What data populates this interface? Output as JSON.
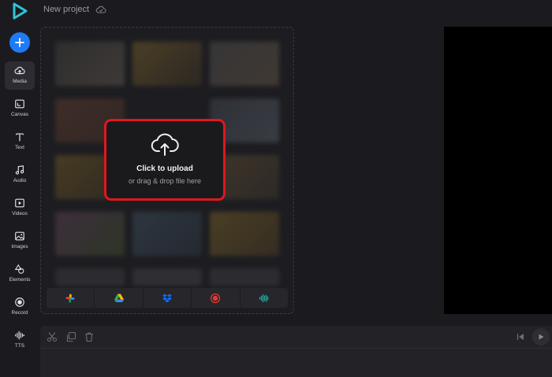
{
  "header": {
    "project_title": "New project",
    "logo_icon": "play-logo-icon",
    "save_status_icon": "cloud-icon"
  },
  "sidebar": {
    "add_icon": "plus-icon",
    "items": [
      {
        "label": "Media",
        "icon": "cloud-upload-icon",
        "active": true
      },
      {
        "label": "Canvas",
        "icon": "canvas-icon"
      },
      {
        "label": "Text",
        "icon": "text-icon"
      },
      {
        "label": "Audio",
        "icon": "music-note-icon"
      },
      {
        "label": "Videos",
        "icon": "video-icon"
      },
      {
        "label": "Images",
        "icon": "image-icon"
      },
      {
        "label": "Elements",
        "icon": "shapes-icon"
      },
      {
        "label": "Record",
        "icon": "record-icon"
      },
      {
        "label": "TTS",
        "icon": "waveform-icon"
      }
    ]
  },
  "media": {
    "upload_title": "Click to upload",
    "upload_subtitle": "or drag & drop file here",
    "sources": [
      {
        "icon": "google-photos-icon"
      },
      {
        "icon": "google-drive-icon"
      },
      {
        "icon": "dropbox-icon"
      },
      {
        "icon": "record-screen-icon"
      },
      {
        "icon": "audio-wave-icon"
      }
    ]
  },
  "timeline": {
    "tools": [
      {
        "icon": "scissors-icon"
      },
      {
        "icon": "duplicate-icon"
      },
      {
        "icon": "trash-icon"
      }
    ],
    "playback": [
      {
        "icon": "skip-back-icon"
      },
      {
        "icon": "play-icon"
      }
    ]
  },
  "colors": {
    "accent": "#1e7bf5",
    "highlight": "#e0161f",
    "background": "#1b1b1f",
    "preview": "#000000"
  }
}
